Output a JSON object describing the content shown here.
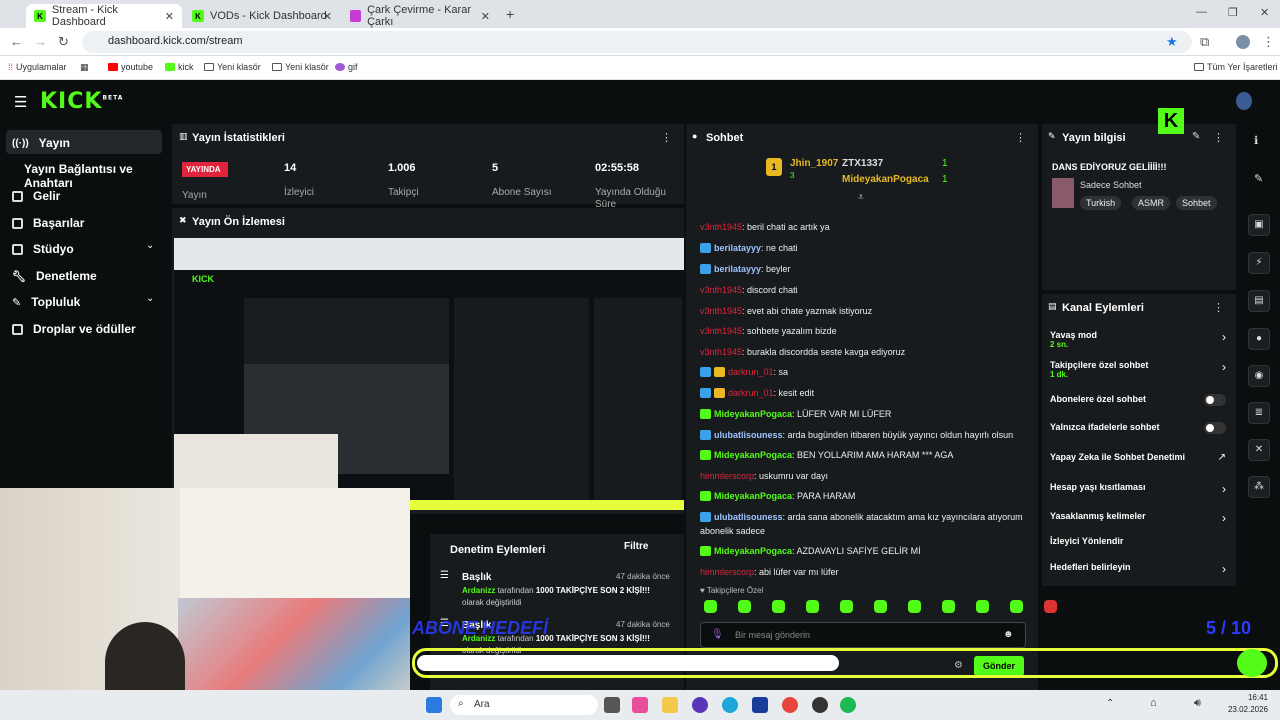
{
  "tabs": [
    {
      "title": "Stream - Kick Dashboard"
    },
    {
      "title": "VODs - Kick Dashboard"
    },
    {
      "title": "Çark Çevirme - Karar Çarkı"
    }
  ],
  "url": "dashboard.kick.com/stream",
  "bookmarks": [
    "Uygulamalar",
    "youtube",
    "kick",
    "Yeni klasör",
    "Yeni klasör",
    "gif"
  ],
  "bookmarks_right": "Tüm Yer İşaretleri",
  "brand": {
    "logo": "KICK",
    "beta": "BETA"
  },
  "sidebar": {
    "items": [
      {
        "label": "Yayın"
      },
      {
        "label": "Yayın Bağlantısı ve Anahtarı"
      },
      {
        "label": "Gelir"
      },
      {
        "label": "Başarılar"
      },
      {
        "label": "Stüdyo"
      },
      {
        "label": "Denetleme"
      },
      {
        "label": "Topluluk"
      },
      {
        "label": "Droplar ve ödüller"
      }
    ]
  },
  "stats": {
    "title": "Yayın İstatistikleri",
    "live_badge": "YAYINDA",
    "items": [
      {
        "label": "Yayın",
        "value": ""
      },
      {
        "label": "İzleyici",
        "value": "14"
      },
      {
        "label": "Takipçi",
        "value": "1.006"
      },
      {
        "label": "Abone Sayısı",
        "value": "5"
      },
      {
        "label": "Yayında Olduğu Süre",
        "value": "02:55:58"
      }
    ]
  },
  "preview": {
    "title": "Yayın Ön İzlemesi"
  },
  "moderation": {
    "title": "Denetim Eylemleri",
    "filter": "Filtre",
    "items": [
      {
        "heading": "Başlık",
        "time": "47 dakika önce",
        "text_a": "Ardanizz",
        "text_b": "tarafından",
        "text_c": "1000 TAKİPÇİYE SON 2 KİŞİ!!!",
        "text_d": "olarak değiştirildi"
      },
      {
        "heading": "Başlık",
        "time": "47 dakika önce",
        "text_a": "Ardanizz",
        "text_b": "tarafından",
        "text_c": "1000 TAKİPÇİYE SON 3 KİŞİ!!!",
        "text_d": "olarak değiştirildi"
      }
    ]
  },
  "overlay": {
    "goal": "ABONE HEDEFİ",
    "count": "5 / 10"
  },
  "chat": {
    "title": "Sohbet",
    "top_users": [
      {
        "name": "Jhin_1907",
        "count": "3"
      },
      {
        "name": "ZTX1337",
        "count": "1"
      },
      {
        "name": "MideyakanPogaca",
        "count": "1"
      }
    ],
    "messages": [
      {
        "user": "v3nth1945",
        "text": ": beril chati ac artık ya",
        "style": "red"
      },
      {
        "user": "berilatayyy",
        "text": ": ne chati",
        "style": "blue"
      },
      {
        "user": "berilatayyy",
        "text": ": beyler",
        "style": "blue"
      },
      {
        "user": "v3nth1945",
        "text": ": discord chati",
        "style": "red"
      },
      {
        "user": "v3nth1945",
        "text": ": evet abi chate yazmak istiyoruz",
        "style": "red"
      },
      {
        "user": "v3nth1945",
        "text": ": sohbete yazalım bizde",
        "style": "red"
      },
      {
        "user": "v3nth1945",
        "text": ": burakla discordda seste kavga ediyoruz",
        "style": "red"
      },
      {
        "user": "darkrun_01",
        "text": ": sa",
        "style": "red"
      },
      {
        "user": "darkrun_01",
        "text": ": kesit edit",
        "style": "red"
      },
      {
        "user": "MideyakanPogaca",
        "text": ": LÜFER VAR MI LÜFER",
        "style": "green"
      },
      {
        "user": "ulubatlisouness",
        "text": ": arda bugünden itibaren büyük yayıncı oldun hayırlı olsun",
        "style": "blue"
      },
      {
        "user": "MideyakanPogaca",
        "text": ": BEN YOLLARIM AMA HARAM *** AGA",
        "style": "green"
      },
      {
        "user": "himmlerscorp",
        "text": ": uskumru var dayı",
        "style": "red"
      },
      {
        "user": "MideyakanPogaca",
        "text": ": PARA HARAM",
        "style": "green"
      },
      {
        "user": "ulubatlisouness",
        "text": ": arda sana abonelik atacaktım ama kız yayıncılara atıyorum",
        "style": "blue"
      },
      {
        "user": "",
        "text": "abonelik sadece",
        "style": "none"
      },
      {
        "user": "MideyakanPogaca",
        "text": ": AZDAVAYLI SAFİYE GELİR Mİ",
        "style": "green"
      },
      {
        "user": "himmlerscorp",
        "text": ": abi lüfer var mı lüfer",
        "style": "red"
      }
    ],
    "followers_only": "Takipçilere Özel",
    "input_placeholder": "Bir mesaj gönderin",
    "send": "Gönder"
  },
  "stream_info": {
    "title": "Yayın bilgisi",
    "stream_title": "DANS EDİYORUZ GELİİİİ!!!",
    "category": "Sadece Sohbet",
    "tags": [
      "Turkish",
      "ASMR",
      "Sohbet"
    ]
  },
  "channel_actions": {
    "title": "Kanal Eylemleri",
    "items": [
      {
        "label": "Yavaş mod",
        "sub": "2 sn.",
        "control": "chevron"
      },
      {
        "label": "Takipçilere özel sohbet",
        "sub": "1 dk.",
        "control": "chevron"
      },
      {
        "label": "Abonelere özel sohbet",
        "sub": "",
        "control": "toggle"
      },
      {
        "label": "Yalnızca ifadelerle sohbet",
        "sub": "",
        "control": "toggle"
      },
      {
        "label": "Yapay Zeka ile Sohbet Denetimi",
        "sub": "",
        "control": "external"
      },
      {
        "label": "Hesap yaşı kısıtlaması",
        "sub": "",
        "control": "chevron"
      },
      {
        "label": "Yasaklanmış kelimeler",
        "sub": "",
        "control": "chevron"
      },
      {
        "label": "İzleyici Yönlendir",
        "sub": "",
        "control": "none"
      },
      {
        "label": "Hedefleri belirleyin",
        "sub": "",
        "control": "chevron"
      }
    ]
  },
  "taskbar": {
    "search": "Ara",
    "time": "16:41",
    "date": "23.02.2026"
  },
  "colors": {
    "accent": "#53fc18",
    "live": "#e0243b"
  }
}
